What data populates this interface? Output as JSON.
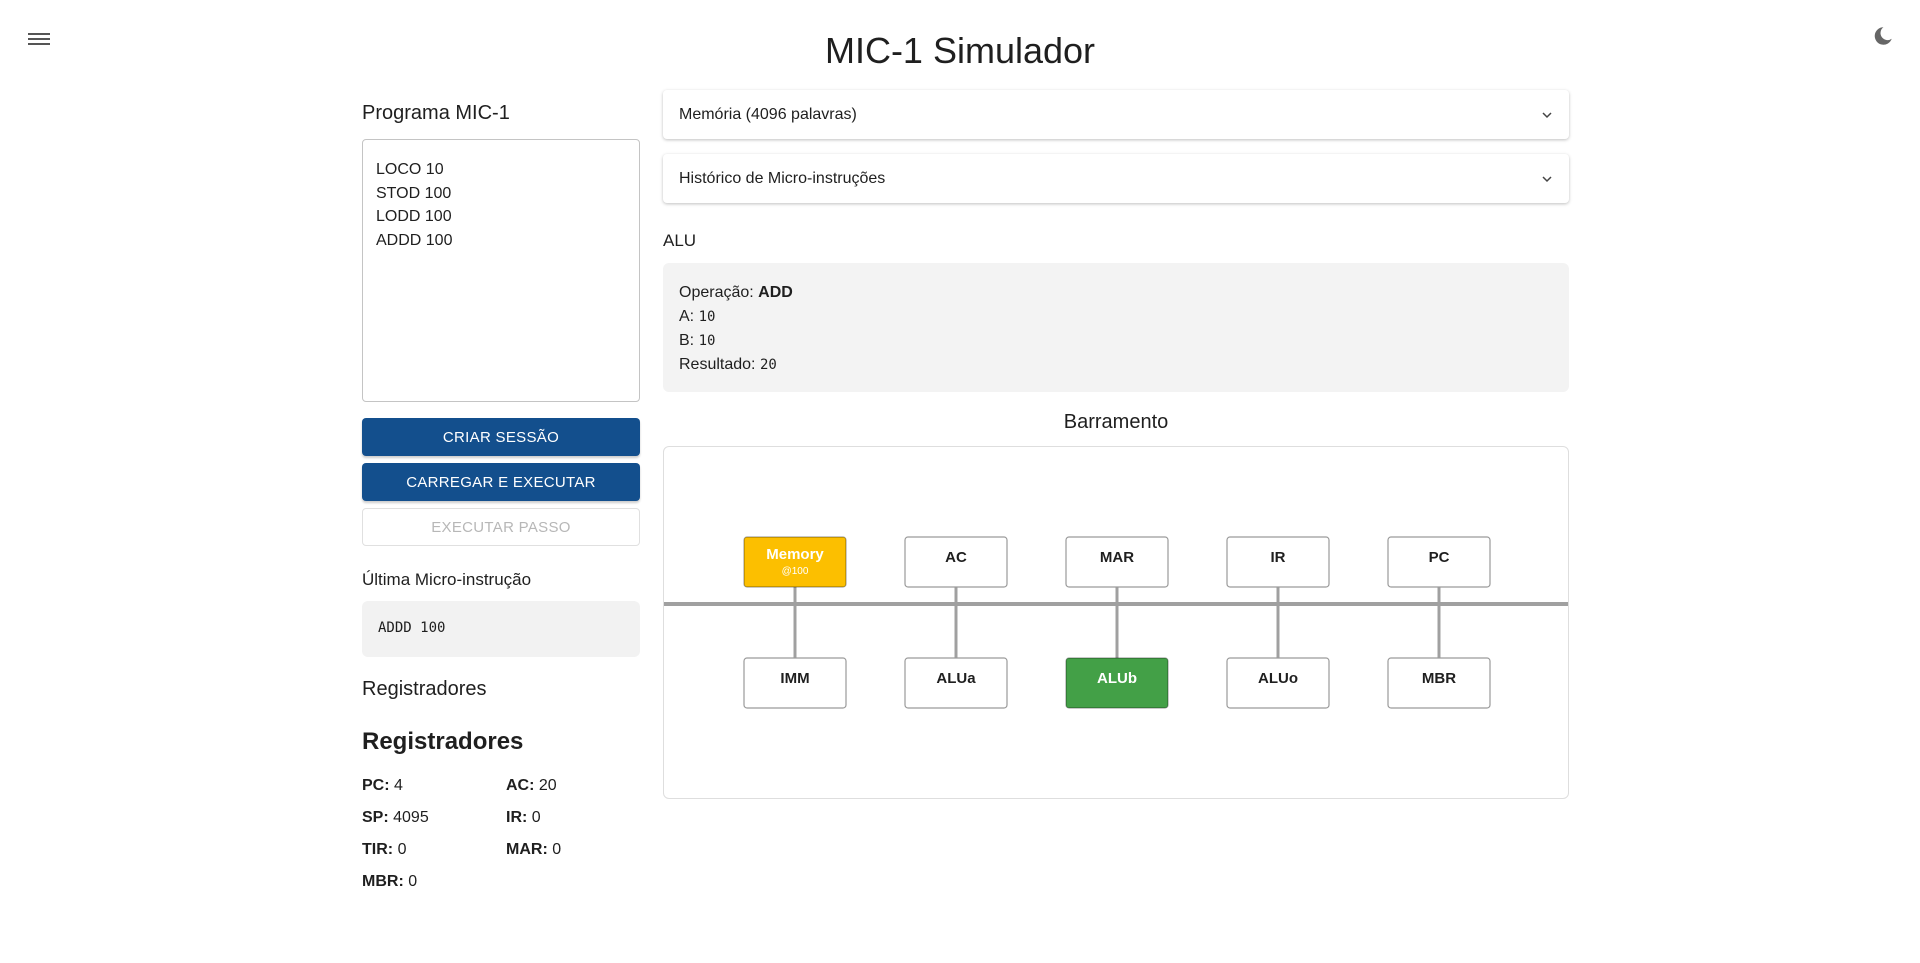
{
  "app": {
    "title": "MIC-1 Simulador"
  },
  "icons": {
    "menu": "menu-icon",
    "theme": "moon-icon",
    "chevron": "chevron-down-icon"
  },
  "program": {
    "heading": "Programa MIC-1",
    "code": "LOCO 10\nSTOD 100\nLODD 100\nADDD 100"
  },
  "buttons": {
    "create_session": "CRIAR SESSÃO",
    "load_run": "CARREGAR E EXECUTAR",
    "step": "EXECUTAR PASSO"
  },
  "last_micro": {
    "label": "Última Micro-instrução",
    "value": "ADDD 100"
  },
  "registers": {
    "heading": "Registradores",
    "subheading": "Registradores",
    "items": [
      {
        "name": "PC:",
        "value": "4"
      },
      {
        "name": "AC:",
        "value": "20"
      },
      {
        "name": "SP:",
        "value": "4095"
      },
      {
        "name": "IR:",
        "value": "0"
      },
      {
        "name": "TIR:",
        "value": "0"
      },
      {
        "name": "MAR:",
        "value": "0"
      },
      {
        "name": "MBR:",
        "value": "0"
      }
    ]
  },
  "accordions": {
    "memory": "Memória (4096 palavras)",
    "history": "Histórico de Micro-instruções"
  },
  "alu": {
    "heading": "ALU",
    "op_label": "Operação:",
    "op_value": "ADD",
    "a_label": "A:",
    "a_value": "10",
    "b_label": "B:",
    "b_value": "10",
    "result_label": "Resultado:",
    "result_value": "20"
  },
  "bus": {
    "heading": "Barramento",
    "top_nodes": [
      {
        "label": "Memory",
        "sub": "@100",
        "state": "active-memory"
      },
      {
        "label": "AC",
        "sub": "",
        "state": "idle"
      },
      {
        "label": "MAR",
        "sub": "",
        "state": "idle"
      },
      {
        "label": "IR",
        "sub": "",
        "state": "idle"
      },
      {
        "label": "PC",
        "sub": "",
        "state": "idle"
      }
    ],
    "bottom_nodes": [
      {
        "label": "IMM",
        "state": "idle"
      },
      {
        "label": "ALUa",
        "state": "idle"
      },
      {
        "label": "ALUb",
        "state": "active-alu"
      },
      {
        "label": "ALUo",
        "state": "idle"
      },
      {
        "label": "MBR",
        "state": "idle"
      }
    ],
    "colors": {
      "memory_active": "#fcbf00",
      "alu_active": "#43a047",
      "bus_line": "#a0a0a0",
      "node_border": "#9a9a9a"
    }
  }
}
